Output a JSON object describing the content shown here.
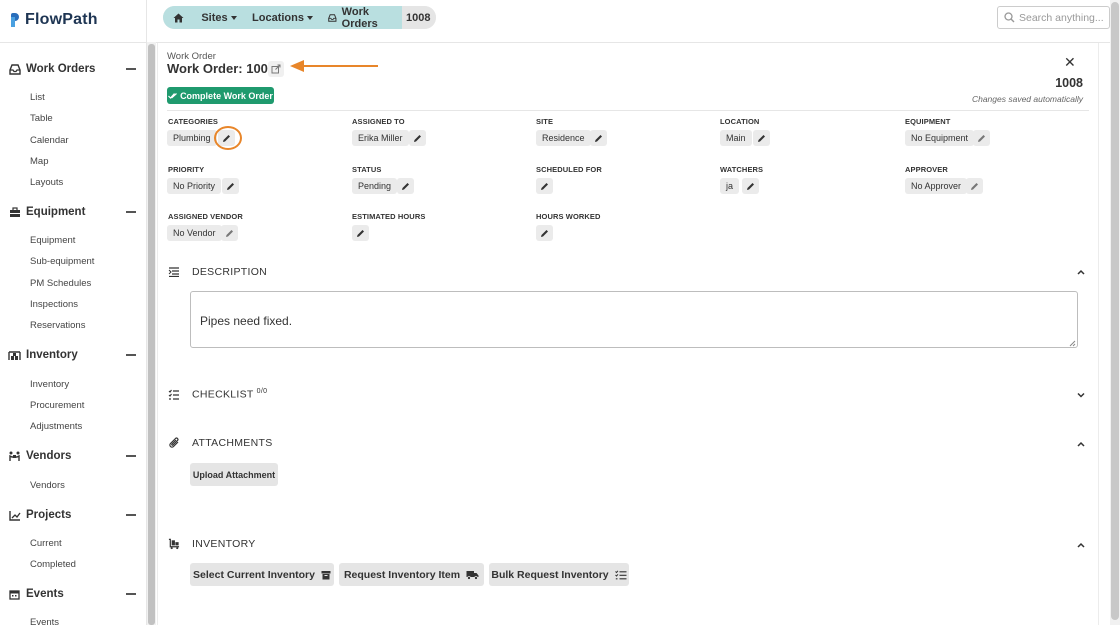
{
  "app": {
    "logo_text": "FlowPath"
  },
  "search": {
    "placeholder": "Search anything..."
  },
  "breadcrumb": {
    "sites": "Sites",
    "locations": "Locations",
    "work_orders": "Work Orders",
    "current": "1008"
  },
  "sidebar": {
    "sections": [
      {
        "label": "Work Orders",
        "icon": "inbox-icon",
        "items": [
          "List",
          "Table",
          "Calendar",
          "Map",
          "Layouts"
        ]
      },
      {
        "label": "Equipment",
        "icon": "toolbox-icon",
        "items": [
          "Equipment",
          "Sub-equipment",
          "PM Schedules",
          "Inspections",
          "Reservations"
        ]
      },
      {
        "label": "Inventory",
        "icon": "warehouse-icon",
        "items": [
          "Inventory",
          "Procurement",
          "Adjustments"
        ]
      },
      {
        "label": "Vendors",
        "icon": "people-carry-icon",
        "items": [
          "Vendors"
        ]
      },
      {
        "label": "Projects",
        "icon": "chart-line-icon",
        "items": [
          "Current",
          "Completed"
        ]
      },
      {
        "label": "Events",
        "icon": "calendar-icon",
        "items": [
          "Events"
        ]
      }
    ]
  },
  "work_order": {
    "kicker": "Work Order",
    "title": "Work Order: 1008",
    "number": "1008",
    "saved_note": "Changes saved automatically",
    "complete_label": "Complete Work Order"
  },
  "fields": {
    "categories": {
      "label": "CATEGORIES",
      "value": "Plumbing"
    },
    "assigned_to": {
      "label": "ASSIGNED TO",
      "value": "Erika Miller"
    },
    "site": {
      "label": "SITE",
      "value": "Residence"
    },
    "location": {
      "label": "LOCATION",
      "value": "Main"
    },
    "equipment": {
      "label": "EQUIPMENT",
      "value": "No Equipment"
    },
    "priority": {
      "label": "PRIORITY",
      "value": "No Priority"
    },
    "status": {
      "label": "STATUS",
      "value": "Pending"
    },
    "scheduled_for": {
      "label": "SCHEDULED FOR",
      "value": ""
    },
    "watchers": {
      "label": "WATCHERS",
      "value": "ja"
    },
    "approver": {
      "label": "APPROVER",
      "value": "No Approver"
    },
    "assigned_vendor": {
      "label": "ASSIGNED VENDOR",
      "value": "No Vendor"
    },
    "estimated_hours": {
      "label": "ESTIMATED HOURS",
      "value": ""
    },
    "hours_worked": {
      "label": "HOURS WORKED",
      "value": ""
    }
  },
  "sections": {
    "description": {
      "title": "DESCRIPTION",
      "text": "Pipes need fixed."
    },
    "checklist": {
      "title": "CHECKLIST",
      "count": "0/0"
    },
    "attachments": {
      "title": "ATTACHMENTS",
      "upload_label": "Upload Attachment"
    },
    "inventory": {
      "title": "INVENTORY",
      "select_label": "Select Current Inventory",
      "request_label": "Request Inventory Item",
      "bulk_label": "Bulk Request Inventory"
    }
  },
  "colors": {
    "accent_green": "#1f9a6e",
    "breadcrumb_teal": "#b9dfe0",
    "annotation_orange": "#e8862a",
    "logo_blue": "#2a6ebb"
  }
}
